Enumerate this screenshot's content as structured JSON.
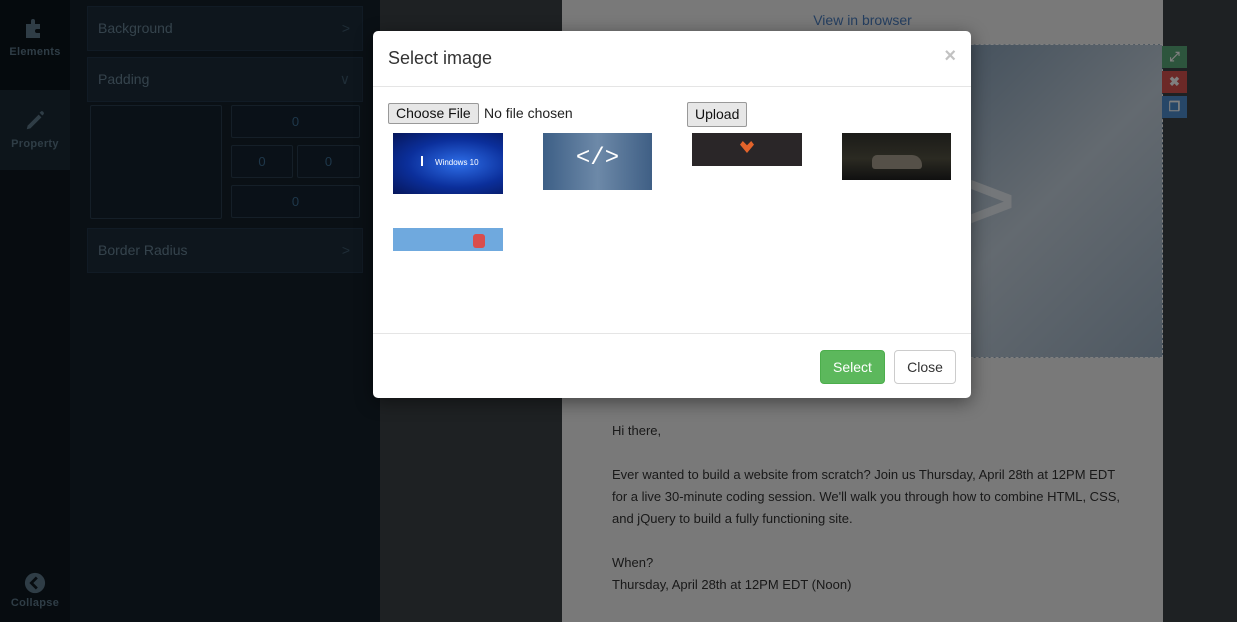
{
  "sidebar": {
    "elements_label": "Elements",
    "property_label": "Property",
    "collapse_label": "Collapse"
  },
  "panel": {
    "background_label": "Background",
    "padding_label": "Padding",
    "border_radius_label": "Border Radius",
    "padding_values": {
      "top": "0",
      "left": "0",
      "right": "0",
      "bottom": "0"
    }
  },
  "email": {
    "view_in_browser": "View in browser",
    "greeting": "Hi there,",
    "paragraph1": "Ever wanted to build a website from scratch? Join us Thursday, April 28th at 12PM EDT for a live 30-minute coding session. We'll walk you through how to combine HTML, CSS, and jQuery to build a fully functioning site.",
    "when_label": "When?",
    "when_value": "Thursday, April 28th at 12PM EDT (Noon)"
  },
  "modal": {
    "title": "Select image",
    "close_glyph": "×",
    "choose_file_label": "Choose File",
    "file_status": "No file chosen",
    "upload_label": "Upload",
    "thumbnails": [
      {
        "caption": "Windows 10"
      },
      {
        "caption": "</>"
      },
      {
        "caption": ""
      },
      {
        "caption": ""
      },
      {
        "caption": ""
      }
    ],
    "select_label": "Select",
    "close_label": "Close"
  },
  "colors": {
    "select_button": "#5cb85c",
    "link": "#4a7ec2",
    "tool_resize": "#5aaa7a",
    "tool_delete": "#d9534f",
    "tool_copy": "#4f8fd0"
  }
}
